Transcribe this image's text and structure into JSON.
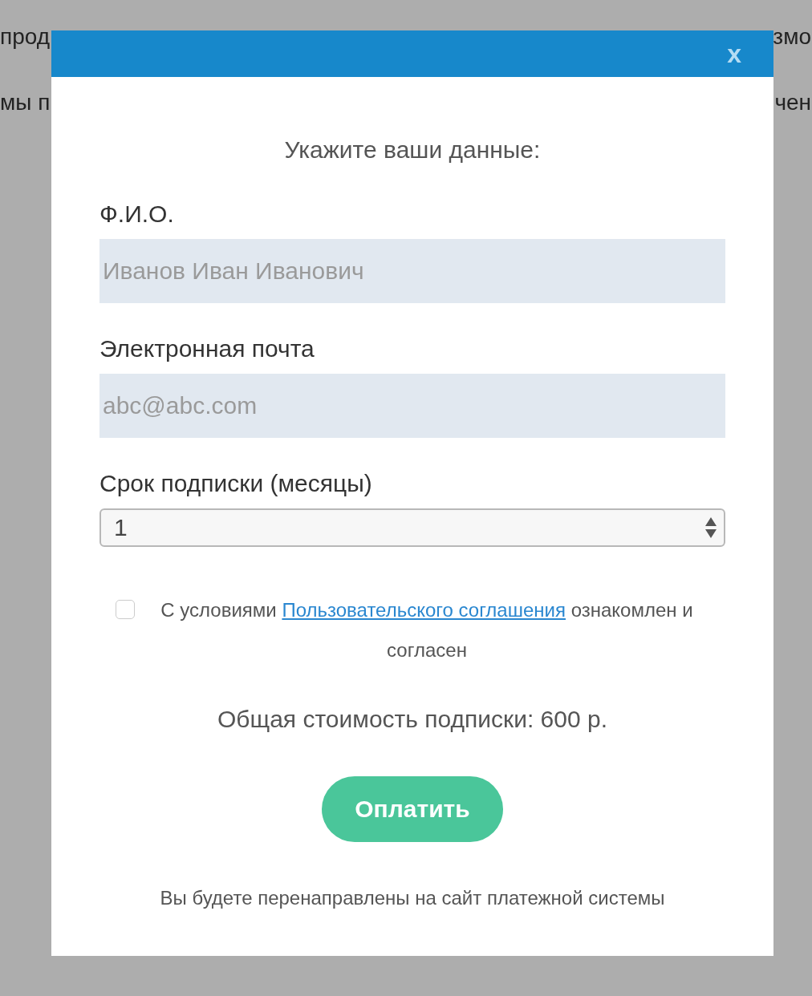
{
  "background_text": {
    "line_1_left": "прод",
    "line_1_right": "змо",
    "line_2_left": "мы п",
    "line_2_right": "чен"
  },
  "dialog": {
    "close": "x",
    "title": "Укажите ваши данные:",
    "fields": [
      {
        "label": "Ф.И.О.",
        "placeholder": "Иванов Иван Иванович"
      },
      {
        "label": "Электронная почта",
        "placeholder": "abc@abc.com"
      }
    ],
    "term": {
      "label": "Срок подписки (месяцы)",
      "value": "1"
    },
    "agreement": {
      "checked": false,
      "before": "С условиями",
      "link": "Пользовательского соглашения",
      "after": "ознакомлен и согласен"
    },
    "total": "Общая стоимость подписки: 600 р.",
    "pay_button": "Оплатить",
    "note": "Вы будете перенаправлены на сайт платежной системы"
  }
}
